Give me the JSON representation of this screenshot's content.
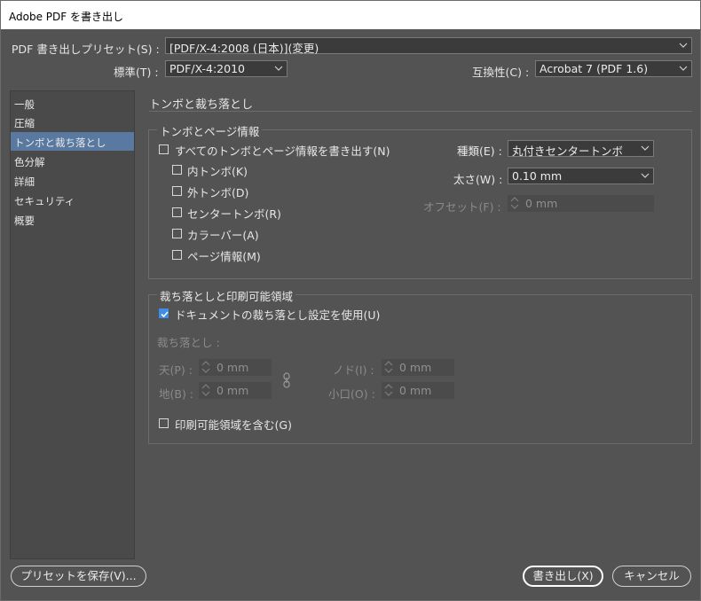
{
  "window": {
    "title": "Adobe PDF を書き出し"
  },
  "preset": {
    "label": "PDF 書き出しプリセット(S) :",
    "value": "[PDF/X-4:2008 (日本)](変更)"
  },
  "standard": {
    "label": "標準(T) :",
    "value": "PDF/X-4:2010"
  },
  "compat": {
    "label": "互換性(C) :",
    "value": "Acrobat 7 (PDF 1.6)"
  },
  "sidebar": {
    "items": [
      {
        "label": "一般"
      },
      {
        "label": "圧縮"
      },
      {
        "label": "トンボと裁ち落とし",
        "selected": true
      },
      {
        "label": "色分解"
      },
      {
        "label": "詳細"
      },
      {
        "label": "セキュリティ"
      },
      {
        "label": "概要"
      }
    ]
  },
  "section": {
    "title": "トンボと裁ち落とし"
  },
  "marks": {
    "group_title": "トンボとページ情報",
    "all_marks": {
      "label": "すべてのトンボとページ情報を書き出す(N)",
      "checked": false
    },
    "options": [
      {
        "label": "内トンボ(K)",
        "checked": false
      },
      {
        "label": "外トンボ(D)",
        "checked": false
      },
      {
        "label": "センタートンボ(R)",
        "checked": false
      },
      {
        "label": "カラーバー(A)",
        "checked": false
      },
      {
        "label": "ページ情報(M)",
        "checked": false
      }
    ],
    "type": {
      "label": "種類(E) :",
      "value": "丸付きセンタートンボ"
    },
    "weight": {
      "label": "太さ(W) :",
      "value": "0.10 mm"
    },
    "offset": {
      "label": "オフセット(F) :",
      "value": "0 mm"
    }
  },
  "bleed": {
    "group_title": "裁ち落としと印刷可能領域",
    "use_doc": {
      "label": "ドキュメントの裁ち落とし設定を使用(U)",
      "checked": true
    },
    "bleed_label": "裁ち落とし :",
    "top": {
      "label": "天(P) :",
      "value": "0 mm"
    },
    "bottom": {
      "label": "地(B) :",
      "value": "0 mm"
    },
    "inside": {
      "label": "ノド(I) :",
      "value": "0 mm"
    },
    "outside": {
      "label": "小口(O) :",
      "value": "0 mm"
    },
    "slug": {
      "label": "印刷可能領域を含む(G)",
      "checked": false
    }
  },
  "buttons": {
    "save_preset": "プリセットを保存(V)...",
    "export": "書き出し(X)",
    "cancel": "キャンセル"
  },
  "icons": {
    "dropdown": "chevron-down-icon",
    "spinner": "spinner-icon",
    "link": "chain-link-icon",
    "check": "checkmark-icon"
  },
  "colors": {
    "background": "#535353",
    "selected": "#5a79a1",
    "checkbox_on": "#3e8ee8"
  }
}
